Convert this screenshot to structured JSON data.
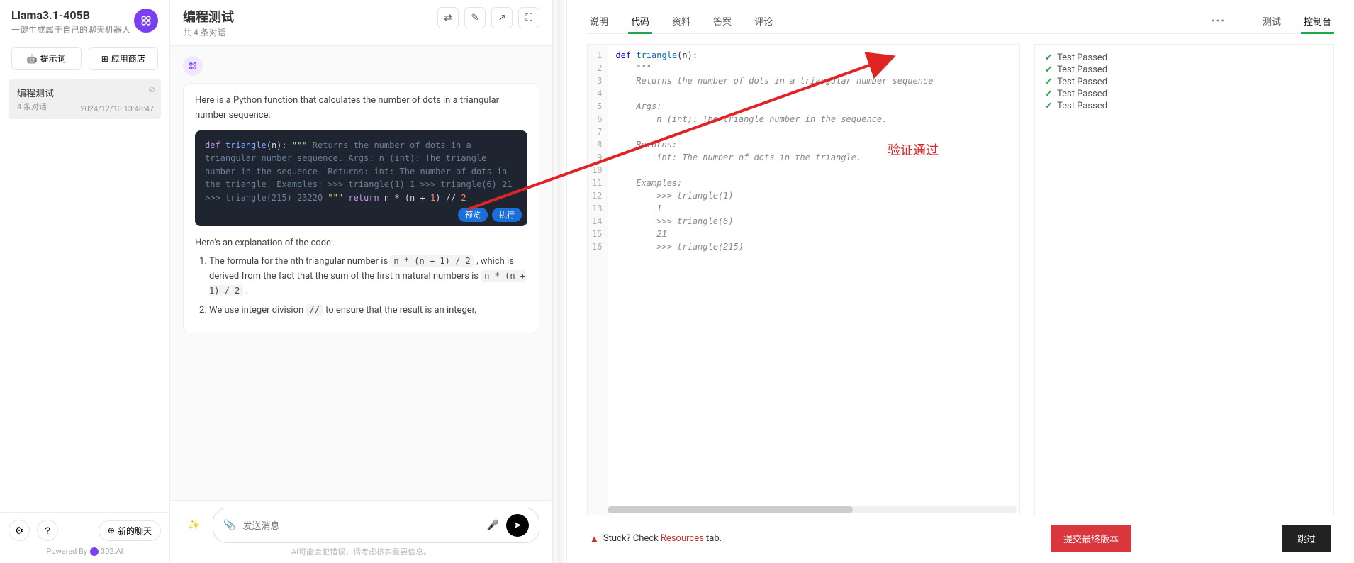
{
  "sidebar": {
    "title": "Llama3.1-405B",
    "subtitle": "一键生成属于自己的聊天机器人",
    "prompt_btn": "提示词",
    "store_btn": "应用商店",
    "conversation": {
      "title": "编程测试",
      "sub": "4 条对话",
      "time": "2024/12/10 13:46:47"
    },
    "new_chat": "新的聊天",
    "powered_by": "Powered By",
    "brand": "302.AI"
  },
  "chat": {
    "title": "编程测试",
    "subtitle": "共 4 条对话",
    "intro": "Here is a Python function that calculates the number of dots in a triangular number sequence:",
    "code_preview_btn": "预览",
    "code_run_btn": "执行",
    "explain_heading": "Here's an explanation of the code:",
    "formula1": "n * (n + 1) / 2",
    "formula2": "n * (n + 1) / 2",
    "intdiv": "//",
    "explain_item1_a": "The formula for the nth triangular number is ",
    "explain_item1_b": " , which is derived from the fact that the sum of the first n natural numbers is ",
    "explain_item1_c": " .",
    "explain_item2_a": "We use integer division ",
    "explain_item2_b": " to ensure that the result is an integer,",
    "placeholder": "发送消息",
    "disclaimer": "AI可能会犯错误，请考虑核实重要信息。",
    "code_lines": [
      "def triangle(n):",
      "    \"\"\"",
      "    Returns the number of dots in a triangular number sequence.",
      "",
      "    Args:",
      "        n (int): The triangle number in the sequence.",
      "",
      "    Returns:",
      "        int: The number of dots in the triangle.",
      "",
      "    Examples:",
      "        >>> triangle(1)",
      "        1",
      "        >>> triangle(6)",
      "        21",
      "        >>> triangle(215)",
      "        23220",
      "    \"\"\"",
      "    return n * (n + 1) // 2"
    ]
  },
  "right": {
    "tabs": [
      "说明",
      "代码",
      "资料",
      "答案",
      "评论"
    ],
    "tabs_right": [
      "测试",
      "控制台"
    ],
    "active_left_tab": 1,
    "active_right_tab": 1,
    "editor_lines": [
      "def triangle(n):",
      "    \"\"\"",
      "    Returns the number of dots in a triangular number sequence",
      "",
      "    Args:",
      "        n (int): The triangle number in the sequence.",
      "",
      "    Returns:",
      "        int: The number of dots in the triangle.",
      "",
      "    Examples:",
      "        >>> triangle(1)",
      "        1",
      "        >>> triangle(6)",
      "        21",
      "        >>> triangle(215)"
    ],
    "line_count": 16,
    "test_results": [
      "Test Passed",
      "Test Passed",
      "Test Passed",
      "Test Passed",
      "Test Passed"
    ],
    "annotation": "验证通过",
    "stuck_prefix": "Stuck? Check ",
    "stuck_link": "Resources",
    "stuck_suffix": " tab.",
    "submit_btn": "提交最终版本",
    "skip_btn": "跳过"
  }
}
